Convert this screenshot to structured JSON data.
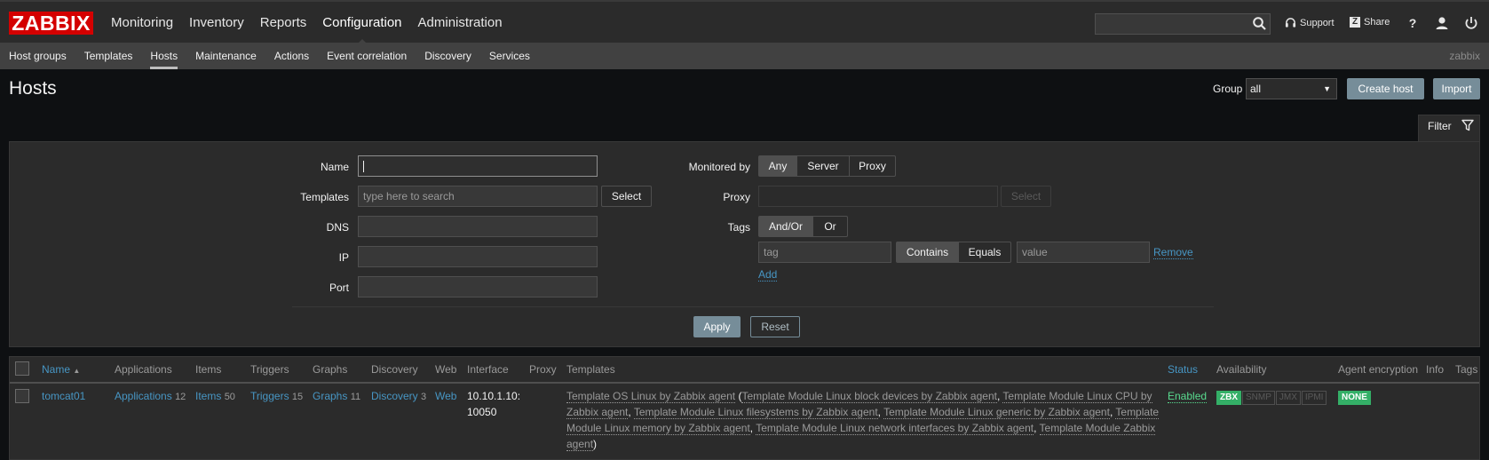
{
  "topbar": {
    "logo": "ZABBIX",
    "menu": [
      {
        "label": "Monitoring"
      },
      {
        "label": "Inventory"
      },
      {
        "label": "Reports"
      },
      {
        "label": "Configuration"
      },
      {
        "label": "Administration"
      }
    ],
    "support_label": "Support",
    "share_label": "Share",
    "help_label": "?"
  },
  "subbar": {
    "menu": [
      {
        "label": "Host groups"
      },
      {
        "label": "Templates"
      },
      {
        "label": "Hosts"
      },
      {
        "label": "Maintenance"
      },
      {
        "label": "Actions"
      },
      {
        "label": "Event correlation"
      },
      {
        "label": "Discovery"
      },
      {
        "label": "Services"
      }
    ],
    "user": "zabbix"
  },
  "header": {
    "title": "Hosts",
    "group_label": "Group",
    "group_value": "all",
    "create_label": "Create host",
    "import_label": "Import"
  },
  "filter": {
    "tab_label": "Filter",
    "name_label": "Name",
    "templates_label": "Templates",
    "templates_placeholder": "type here to search",
    "select_label": "Select",
    "dns_label": "DNS",
    "ip_label": "IP",
    "port_label": "Port",
    "monitored_label": "Monitored by",
    "monitored_options": [
      "Any",
      "Server",
      "Proxy"
    ],
    "proxy_label": "Proxy",
    "proxy_select_label": "Select",
    "tags_label": "Tags",
    "tags_options": [
      "And/Or",
      "Or"
    ],
    "tag_placeholder": "tag",
    "op_options": [
      "Contains",
      "Equals"
    ],
    "value_placeholder": "value",
    "remove_label": "Remove",
    "add_label": "Add",
    "apply_label": "Apply",
    "reset_label": "Reset"
  },
  "table": {
    "headers": {
      "name": "Name",
      "applications": "Applications",
      "items": "Items",
      "triggers": "Triggers",
      "graphs": "Graphs",
      "discovery": "Discovery",
      "web": "Web",
      "interface": "Interface",
      "proxy": "Proxy",
      "templates": "Templates",
      "status": "Status",
      "availability": "Availability",
      "encryption": "Agent encryption",
      "info": "Info",
      "tags": "Tags"
    },
    "rows": [
      {
        "name": "tomcat01",
        "applications": "Applications",
        "applications_count": "12",
        "items": "Items",
        "items_count": "50",
        "triggers": "Triggers",
        "triggers_count": "15",
        "graphs": "Graphs",
        "graphs_count": "11",
        "discovery": "Discovery",
        "discovery_count": "3",
        "web": "Web",
        "interface_line1": "10.10.1.10:",
        "interface_line2": "10050",
        "tpl_main": "Template OS Linux by Zabbix agent",
        "tpl_open": " (",
        "tpl_1": "Template Module Linux block devices by Zabbix agent",
        "tpl_2": "Template Module Linux CPU by Zabbix agent",
        "tpl_3": "Template Module Linux filesystems by Zabbix agent",
        "tpl_4": "Template Module Linux generic by Zabbix agent",
        "tpl_5": "Template Module Linux memory by Zabbix agent",
        "tpl_6": "Template Module Linux network interfaces by Zabbix agent",
        "tpl_7": "Template Module Zabbix agent",
        "tpl_sep": ", ",
        "tpl_close": ")",
        "status": "Enabled",
        "avail": [
          "ZBX",
          "SNMP",
          "JMX",
          "IPMI"
        ],
        "encryption": "NONE"
      }
    ]
  }
}
